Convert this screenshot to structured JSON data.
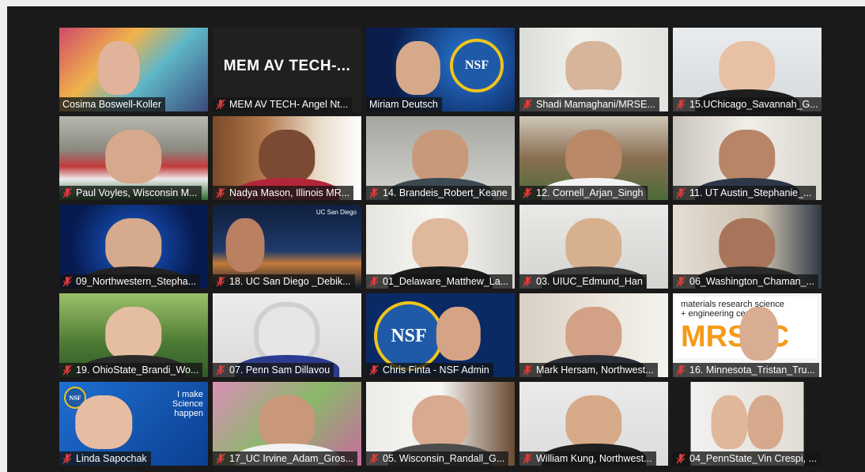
{
  "meeting": {
    "tiles": [
      {
        "name": "Cosima Boswell-Koller",
        "muted": false,
        "active": true
      },
      {
        "name": "MEM AV TECH- Angel Nt...",
        "muted": true,
        "display_name": "MEM AV TECH-..."
      },
      {
        "name": "Miriam Deutsch",
        "muted": false
      },
      {
        "name": "Shadi Mamaghani/MRSE...",
        "muted": true
      },
      {
        "name": "15.UChicago_Savannah_G...",
        "muted": true
      },
      {
        "name": "Paul Voyles, Wisconsin M...",
        "muted": true
      },
      {
        "name": "Nadya Mason, Illinois MR...",
        "muted": true
      },
      {
        "name": "14. Brandeis_Robert_Keane",
        "muted": true
      },
      {
        "name": "12. Cornell_Arjan_Singh",
        "muted": true
      },
      {
        "name": "11. UT Austin_Stephanie_...",
        "muted": true
      },
      {
        "name": "09_Northwestern_Stepha...",
        "muted": true
      },
      {
        "name": "18. UC San Diego _Debik...",
        "muted": true
      },
      {
        "name": "01_Delaware_Matthew_La...",
        "muted": true
      },
      {
        "name": "03. UIUC_Edmund_Han",
        "muted": true
      },
      {
        "name": "06_Washington_Chaman_...",
        "muted": true
      },
      {
        "name": "19. OhioState_Brandi_Wo...",
        "muted": true
      },
      {
        "name": "07. Penn Sam Dillavou",
        "muted": true
      },
      {
        "name": "Chris Finta - NSF Admin",
        "muted": true
      },
      {
        "name": "Mark Hersam, Northwest...",
        "muted": true
      },
      {
        "name": "16. Minnesota_Tristan_Tru...",
        "muted": true
      },
      {
        "name": "Linda Sapochak",
        "muted": true
      },
      {
        "name": "17_UC Irvine_Adam_Gros...",
        "muted": true
      },
      {
        "name": "05. Wisconsin_Randall_G...",
        "muted": true
      },
      {
        "name": "William Kung, Northwest...",
        "muted": true
      },
      {
        "name": "04_PennState_Vin Crespi, ...",
        "muted": true
      }
    ]
  },
  "overlays": {
    "nsf": "NSF",
    "sign_line1": "materials research science",
    "sign_line2": "+ engineering center",
    "sign_big": "MRSEC",
    "science_line1": "I make",
    "science_line2": "Science",
    "science_line3": "happen",
    "ucsd": "UC San Diego"
  },
  "colors": {
    "active_border": "#e5e36b",
    "mute_icon": "#e03b3b",
    "label_bg": "#141414"
  }
}
